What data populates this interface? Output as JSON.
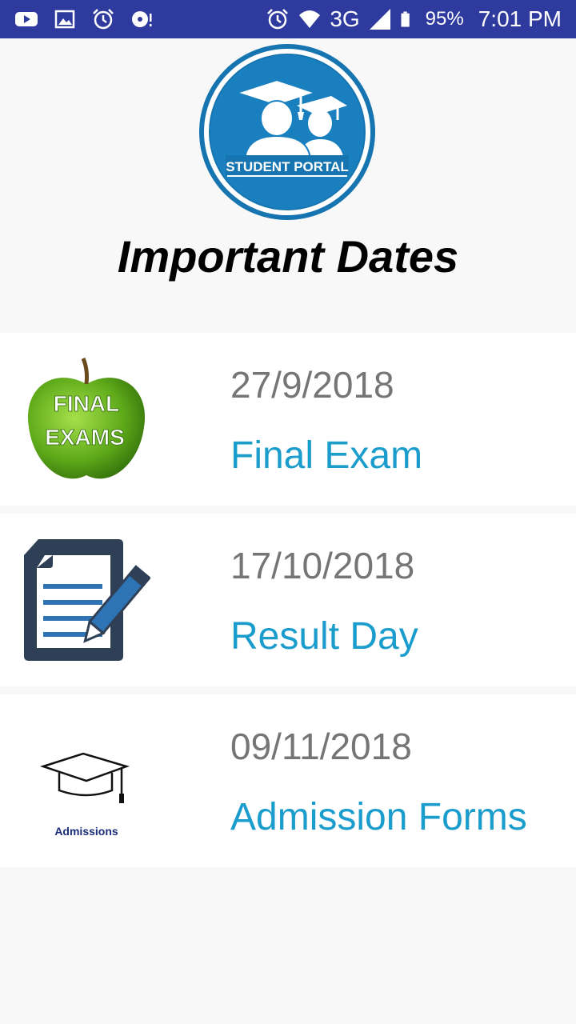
{
  "status_bar": {
    "battery": "95%",
    "network": "3G",
    "time": "7:01 PM",
    "icons": [
      "youtube-icon",
      "gallery-icon",
      "alarm-icon",
      "music-icon",
      "alarm-icon",
      "wifi-icon",
      "signal-icon",
      "battery-icon"
    ]
  },
  "header": {
    "logo_text": "STUDENT PORTAL",
    "title": "Important Dates"
  },
  "events": [
    {
      "date": "27/9/2018",
      "title": "Final Exam",
      "image_text_1": "FINAL",
      "image_text_2": "EXAMS"
    },
    {
      "date": "17/10/2018",
      "title": "Result Day"
    },
    {
      "date": "09/11/2018",
      "title": "Admission Forms",
      "image_text": "Admissions"
    }
  ],
  "colors": {
    "status_bar": "#2f3a9e",
    "accent": "#1a9ccc",
    "date": "#757575",
    "background": "#f8f8f8"
  }
}
